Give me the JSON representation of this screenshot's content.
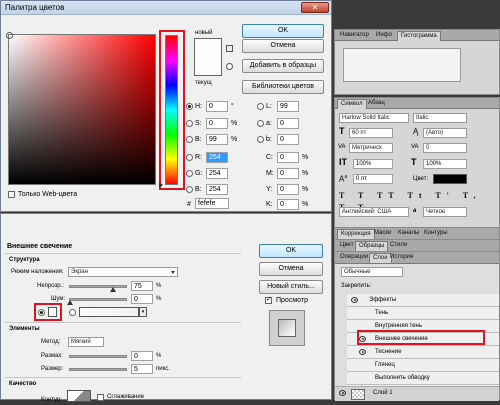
{
  "color_picker": {
    "title": "Палитра цветов",
    "new_label": "новый",
    "current_label": "текущ",
    "ok": "OK",
    "cancel": "Отмена",
    "add_swatches": "Добавить в образцы",
    "color_libraries": "Библиотеки цветов",
    "web_only": "Только Web-цвета",
    "fields": {
      "h": {
        "label": "H:",
        "value": "0",
        "unit": "°"
      },
      "s": {
        "label": "S:",
        "value": "0",
        "unit": "%"
      },
      "b": {
        "label": "B:",
        "value": "99",
        "unit": "%"
      },
      "r": {
        "label": "R:",
        "value": "254"
      },
      "g": {
        "label": "G:",
        "value": "254"
      },
      "bl": {
        "label": "B:",
        "value": "254"
      },
      "l": {
        "label": "L:",
        "value": "99"
      },
      "a": {
        "label": "a:",
        "value": "0"
      },
      "b2": {
        "label": "b:",
        "value": "0"
      },
      "c": {
        "label": "C:",
        "value": "0",
        "unit": "%"
      },
      "m": {
        "label": "M:",
        "value": "0",
        "unit": "%"
      },
      "y": {
        "label": "Y:",
        "value": "0",
        "unit": "%"
      },
      "k": {
        "label": "K:",
        "value": "0",
        "unit": "%"
      },
      "hex": {
        "label": "#",
        "value": "fefefe"
      }
    }
  },
  "layer_style": {
    "section_title": "Внешнее свечение",
    "structure": "Структура",
    "blend_mode_label": "Режим наложения:",
    "blend_mode_value": "Экран",
    "opacity_label": "Непрозр.:",
    "opacity_value": "75",
    "noise_label": "Шум:",
    "noise_value": "0",
    "elements": "Элементы",
    "method_label": "Метод:",
    "method_value": "Мягкий",
    "spread_label": "Размах:",
    "spread_value": "0",
    "size_label": "Размер:",
    "size_value": "5",
    "quality": "Качество",
    "contour_label": "Контур:",
    "antialias_label": "Сглаживание",
    "pct": "%",
    "px": "пикс.",
    "ok": "OK",
    "cancel": "Отмена",
    "new_style": "Новый стиль...",
    "preview": "Просмотр"
  },
  "panels": {
    "navigator_tabs": [
      "Навигатор",
      "Инфо",
      "Гистограмма"
    ],
    "character_tabs": [
      "Символ",
      "Абзац"
    ],
    "font_family": "Harlow Solid Italic",
    "font_style": "Italic",
    "font_size": "60 пт",
    "leading": "(Авто)",
    "kerning": "Метрическ",
    "tracking": "0",
    "vscale": "100%",
    "hscale": "100%",
    "baseline": "0 пт",
    "color_label": "Цвет:",
    "language": "Английский: США",
    "aa_prefix": "a",
    "aa": "Четкое",
    "adjust_tabs": [
      "Коррекция",
      "Маски",
      "Каналы",
      "Контуры"
    ],
    "swatch_tabs": [
      "Цвет",
      "Образцы",
      "Стили"
    ],
    "layer_tabs": [
      "Операции",
      "Слои",
      "История"
    ],
    "blend": "Обычные",
    "lock": "Закрепить:",
    "layers": [
      "Эффекты",
      "Тень",
      "Внутренняя тень",
      "Внешнее свечение",
      "Тиснение",
      "Глянец",
      "Выполнить обводку",
      "Слой 1"
    ]
  }
}
